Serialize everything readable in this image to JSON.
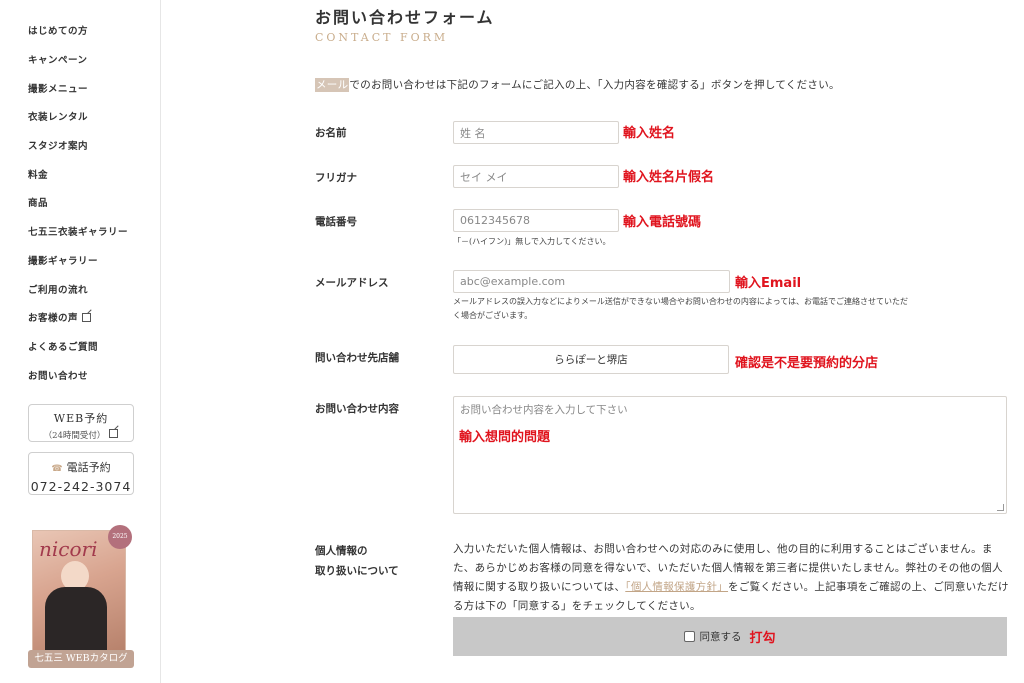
{
  "sidebar": {
    "nav": [
      {
        "label": "はじめての方"
      },
      {
        "label": "キャンペーン"
      },
      {
        "label": "撮影メニュー"
      },
      {
        "label": "衣装レンタル"
      },
      {
        "label": "スタジオ案内"
      },
      {
        "label": "料金"
      },
      {
        "label": "商品"
      },
      {
        "label": "七五三衣装ギャラリー"
      },
      {
        "label": "撮影ギャラリー"
      },
      {
        "label": "ご利用の流れ"
      },
      {
        "label": "お客様の声"
      },
      {
        "label": "よくあるご質問"
      },
      {
        "label": "お問い合わせ"
      }
    ],
    "web_booking": {
      "line1": "WEB予約",
      "line2": "（24時間受付）"
    },
    "tel_booking": {
      "line1": "電話予約",
      "phone": "072-242-3074"
    },
    "catalog": {
      "cover_title": "nicori",
      "badge": "2025",
      "label": "七五三 WEBカタログ"
    }
  },
  "main": {
    "title": "お問い合わせフォーム",
    "subtitle": "CONTACT FORM",
    "intro_highlight": "メール",
    "intro_rest": "でのお問い合わせは下記のフォームにご記入の上、「入力内容を確認する」ボタンを押してください。",
    "fields": {
      "name": {
        "label": "お名前",
        "placeholder": "姓 名",
        "annotation": "輸入姓名"
      },
      "kana": {
        "label": "フリガナ",
        "placeholder": "セイ メイ",
        "annotation": "輸入姓名片假名"
      },
      "phone": {
        "label": "電話番号",
        "placeholder": "0612345678",
        "note": "「－(ハイフン)」無しで入力してください。",
        "annotation": "輸入電話號碼"
      },
      "email": {
        "label": "メールアドレス",
        "placeholder": "abc@example.com",
        "note1": "メールアドレスの誤入力などによりメール送信ができない場合やお問い合わせの内容によっては、お電話でご連絡させていただ",
        "note2": "く場合がございます。",
        "annotation": "輸入Email"
      },
      "store": {
        "label": "問い合わせ先店舗",
        "value": "ららぽーと堺店",
        "annotation": "確認是不是要預約的分店"
      },
      "content": {
        "label": "お問い合わせ内容",
        "placeholder": "お問い合わせ内容を入力して下さい",
        "annotation": "輸入想問的問題"
      }
    },
    "privacy": {
      "label1": "個人情報の",
      "label2": "取り扱いについて",
      "text_before": "入力いただいた個人情報は、お問い合わせへの対応のみに使用し、他の目的に利用することはございません。また、あらかじめお客様の同意を得ないで、いただいた個人情報を第三者に提供いたしません。弊社のその他の個人情報に関する取り扱いについては、",
      "link": "「個人情報保護方針」",
      "text_after": "をご覧ください。上記事項をご確認の上、ご同意いただける方は下の「同意する」をチェックしてください。",
      "agree_label": "同意する",
      "agree_annotation": "打勾"
    }
  }
}
